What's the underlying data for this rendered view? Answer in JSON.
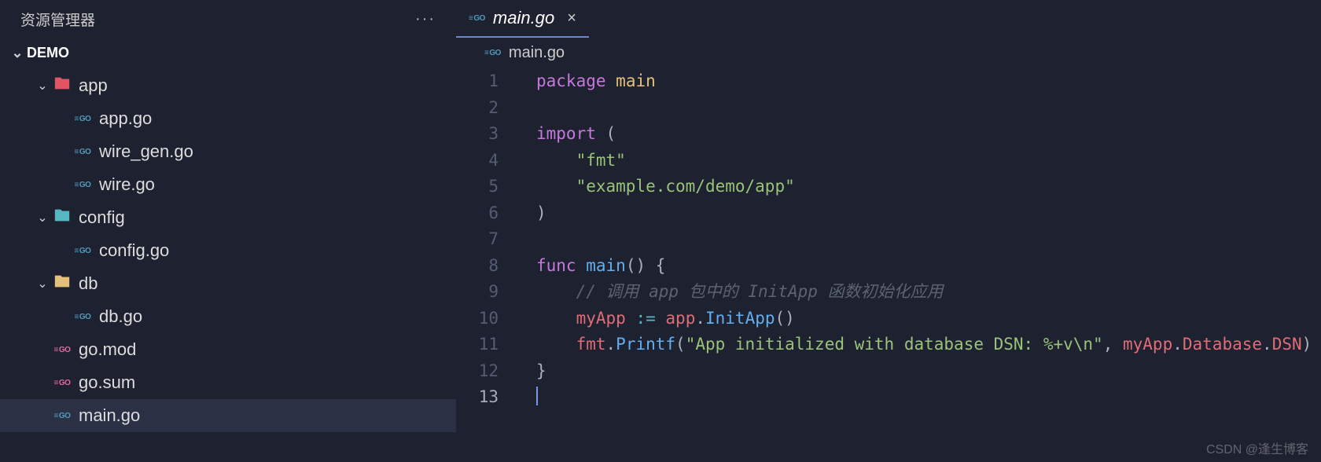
{
  "sidebar": {
    "title": "资源管理器",
    "menu_icon": "···",
    "project_name": "DEMO",
    "tree": [
      {
        "type": "folder",
        "label": "app",
        "depth": 1,
        "expanded": true,
        "iconClass": "folder-app"
      },
      {
        "type": "file",
        "label": "app.go",
        "depth": 2,
        "icon": "go"
      },
      {
        "type": "file",
        "label": "wire_gen.go",
        "depth": 2,
        "icon": "go"
      },
      {
        "type": "file",
        "label": "wire.go",
        "depth": 2,
        "icon": "go"
      },
      {
        "type": "folder",
        "label": "config",
        "depth": 1,
        "expanded": true,
        "iconClass": "folder-config"
      },
      {
        "type": "file",
        "label": "config.go",
        "depth": 2,
        "icon": "go"
      },
      {
        "type": "folder",
        "label": "db",
        "depth": 1,
        "expanded": true,
        "iconClass": "folder-db"
      },
      {
        "type": "file",
        "label": "db.go",
        "depth": 2,
        "icon": "go"
      },
      {
        "type": "file",
        "label": "go.mod",
        "depth": 1,
        "icon": "gomod"
      },
      {
        "type": "file",
        "label": "go.sum",
        "depth": 1,
        "icon": "gomod"
      },
      {
        "type": "file",
        "label": "main.go",
        "depth": 1,
        "icon": "go",
        "selected": true
      }
    ]
  },
  "tab": {
    "label": "main.go",
    "close": "×"
  },
  "crumb": {
    "label": "main.go"
  },
  "code": {
    "lines": [
      {
        "n": 1,
        "seg": [
          {
            "c": "kw",
            "t": "package"
          },
          {
            "c": "tk",
            "t": " "
          },
          {
            "c": "pkg",
            "t": "main"
          }
        ]
      },
      {
        "n": 2,
        "seg": []
      },
      {
        "n": 3,
        "seg": [
          {
            "c": "kw",
            "t": "import"
          },
          {
            "c": "tk",
            "t": " "
          },
          {
            "c": "pnc",
            "t": "("
          }
        ]
      },
      {
        "n": 4,
        "seg": [
          {
            "c": "tk",
            "t": "    "
          },
          {
            "c": "str",
            "t": "\"fmt\""
          }
        ]
      },
      {
        "n": 5,
        "seg": [
          {
            "c": "tk",
            "t": "    "
          },
          {
            "c": "str",
            "t": "\"example.com/demo/app\""
          }
        ]
      },
      {
        "n": 6,
        "seg": [
          {
            "c": "pnc",
            "t": ")"
          }
        ]
      },
      {
        "n": 7,
        "seg": []
      },
      {
        "n": 8,
        "seg": [
          {
            "c": "kw",
            "t": "func"
          },
          {
            "c": "tk",
            "t": " "
          },
          {
            "c": "fn",
            "t": "main"
          },
          {
            "c": "pnc",
            "t": "() {"
          }
        ]
      },
      {
        "n": 9,
        "seg": [
          {
            "c": "tk",
            "t": "    "
          },
          {
            "c": "cmt",
            "t": "// 调用 app 包中的 InitApp 函数初始化应用"
          }
        ]
      },
      {
        "n": 10,
        "seg": [
          {
            "c": "tk",
            "t": "    "
          },
          {
            "c": "var",
            "t": "myApp"
          },
          {
            "c": "tk",
            "t": " "
          },
          {
            "c": "op",
            "t": ":="
          },
          {
            "c": "tk",
            "t": " "
          },
          {
            "c": "var",
            "t": "app"
          },
          {
            "c": "pnc",
            "t": "."
          },
          {
            "c": "fn",
            "t": "InitApp"
          },
          {
            "c": "pnc",
            "t": "()"
          }
        ]
      },
      {
        "n": 11,
        "seg": [
          {
            "c": "tk",
            "t": "    "
          },
          {
            "c": "var",
            "t": "fmt"
          },
          {
            "c": "pnc",
            "t": "."
          },
          {
            "c": "fn",
            "t": "Printf"
          },
          {
            "c": "pnc",
            "t": "("
          },
          {
            "c": "str",
            "t": "\"App initialized with database DSN: %+v\\n\""
          },
          {
            "c": "pnc",
            "t": ", "
          },
          {
            "c": "var",
            "t": "myApp"
          },
          {
            "c": "pnc",
            "t": "."
          },
          {
            "c": "prop",
            "t": "Database"
          },
          {
            "c": "pnc",
            "t": "."
          },
          {
            "c": "prop",
            "t": "DSN"
          },
          {
            "c": "pnc",
            "t": ")"
          }
        ]
      },
      {
        "n": 12,
        "seg": [
          {
            "c": "pnc",
            "t": "}"
          }
        ]
      },
      {
        "n": 13,
        "seg": [],
        "current": true
      }
    ]
  },
  "watermark": "CSDN @逢生博客"
}
